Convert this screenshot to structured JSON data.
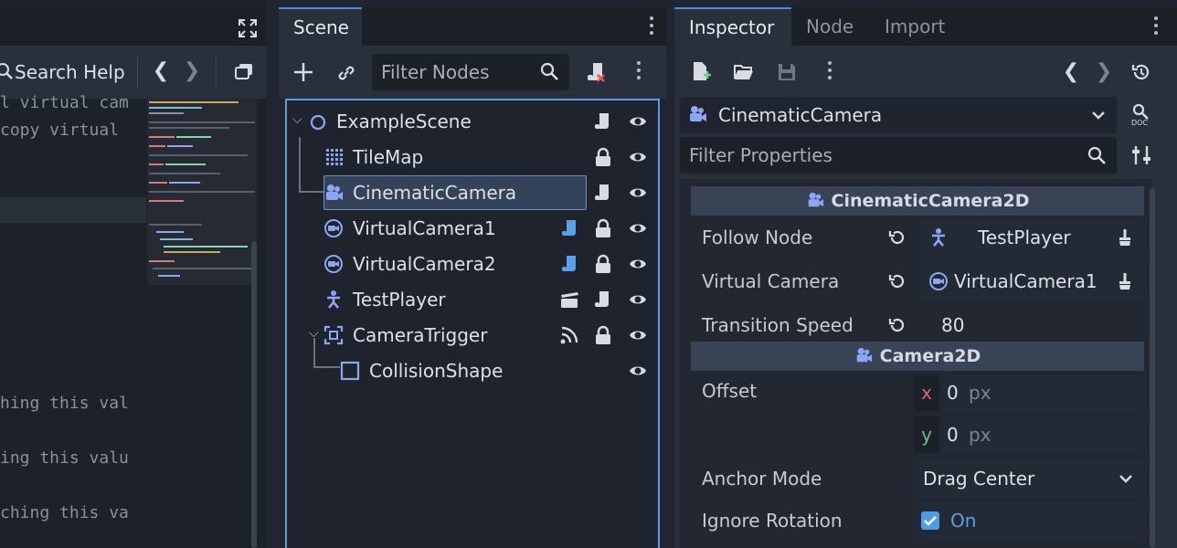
{
  "left_panel": {
    "code_lines": [
      {
        "text": "l virtual cam"
      },
      {
        "text": " copy virtual"
      },
      {
        "text": "hing this val"
      },
      {
        "text": "ing this valu"
      },
      {
        "text": "ching this va"
      }
    ],
    "search_help_label": "Search Help"
  },
  "scene_dock": {
    "tab_label": "Scene",
    "filter_placeholder": "Filter Nodes",
    "nodes": [
      {
        "name": "ExampleScene"
      },
      {
        "name": "TileMap"
      },
      {
        "name": "CinematicCamera"
      },
      {
        "name": "VirtualCamera1"
      },
      {
        "name": "VirtualCamera2"
      },
      {
        "name": "TestPlayer"
      },
      {
        "name": "CameraTrigger"
      },
      {
        "name": "CollisionShape"
      }
    ],
    "accent_color": "#5a9be0"
  },
  "inspector": {
    "tabs": [
      {
        "label": "Inspector"
      },
      {
        "label": "Node"
      },
      {
        "label": "Import"
      }
    ],
    "object_name": "CinematicCamera",
    "filter_placeholder": "Filter Properties",
    "section_cinematic": "CinematicCamera2D",
    "section_camera": "Camera2D",
    "props": {
      "follow_node": {
        "label": "Follow Node",
        "value": "TestPlayer"
      },
      "virtual_camera": {
        "label": "Virtual Camera",
        "value": "VirtualCamera1"
      },
      "transition_speed": {
        "label": "Transition Speed",
        "value": "80"
      },
      "offset": {
        "label": "Offset",
        "x_axis": "x",
        "x_value": "0",
        "y_axis": "y",
        "y_value": "0",
        "unit": "px"
      },
      "anchor_mode": {
        "label": "Anchor Mode",
        "value": "Drag Center"
      },
      "ignore_rotation": {
        "label": "Ignore Rotation",
        "value": "On"
      }
    },
    "checkbox_color": "#4f9be8",
    "node_icon_color": "#8da5f3"
  }
}
